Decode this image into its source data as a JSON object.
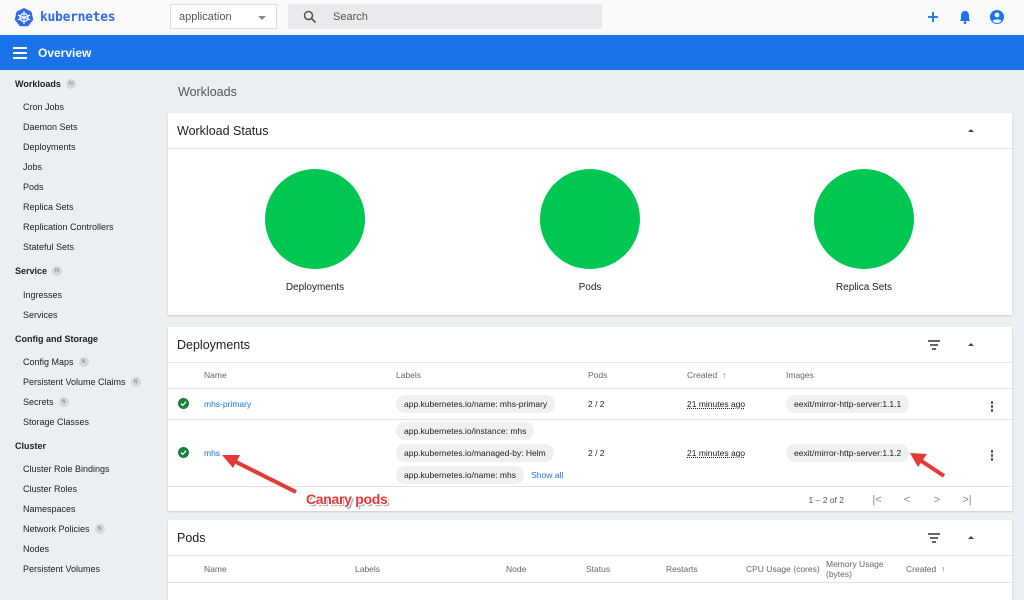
{
  "app": {
    "name": "kubernetes"
  },
  "topbar": {
    "namespace": "application",
    "search_placeholder": "Search",
    "icons": [
      "plus-icon",
      "bell-icon",
      "account-circle-icon"
    ]
  },
  "header": {
    "title": "Overview"
  },
  "sidebar": {
    "badge": "N",
    "sections": [
      {
        "label": "Workloads",
        "badge": true,
        "items": [
          {
            "label": "Cron Jobs"
          },
          {
            "label": "Daemon Sets"
          },
          {
            "label": "Deployments"
          },
          {
            "label": "Jobs"
          },
          {
            "label": "Pods"
          },
          {
            "label": "Replica Sets"
          },
          {
            "label": "Replication Controllers"
          },
          {
            "label": "Stateful Sets"
          }
        ]
      },
      {
        "label": "Service",
        "badge": true,
        "items": [
          {
            "label": "Ingresses"
          },
          {
            "label": "Services"
          }
        ]
      },
      {
        "label": "Config and Storage",
        "badge": false,
        "items": [
          {
            "label": "Config Maps",
            "badge": true
          },
          {
            "label": "Persistent Volume Claims",
            "badge": true
          },
          {
            "label": "Secrets",
            "badge": true
          },
          {
            "label": "Storage Classes"
          }
        ]
      },
      {
        "label": "Cluster",
        "badge": false,
        "items": [
          {
            "label": "Cluster Role Bindings"
          },
          {
            "label": "Cluster Roles"
          },
          {
            "label": "Namespaces"
          },
          {
            "label": "Network Policies",
            "badge": true
          },
          {
            "label": "Nodes"
          },
          {
            "label": "Persistent Volumes"
          }
        ]
      }
    ]
  },
  "main": {
    "page_title": "Workloads",
    "workload_status": {
      "title": "Workload Status",
      "items": [
        {
          "label": "Deployments",
          "status": "running",
          "color": "#00c752"
        },
        {
          "label": "Pods",
          "status": "running",
          "color": "#00c752"
        },
        {
          "label": "Replica Sets",
          "status": "running",
          "color": "#00c752"
        }
      ]
    },
    "deployments": {
      "title": "Deployments",
      "columns": [
        "Name",
        "Labels",
        "Pods",
        "Created",
        "Images"
      ],
      "sort_indicator": "↑",
      "rows": [
        {
          "name": "mhs-primary",
          "labels": [
            "app.kubernetes.io/name: mhs-primary"
          ],
          "pods": "2 / 2",
          "created": "21 minutes ago",
          "image": "eexit/mirror-http-server:1.1.1"
        },
        {
          "name": "mhs",
          "labels": [
            "app.kubernetes.io/instance: mhs",
            "app.kubernetes.io/managed-by: Helm",
            "app.kubernetes.io/name: mhs"
          ],
          "show_all": "Show all",
          "pods": "2 / 2",
          "created": "21 minutes ago",
          "image": "eexit/mirror-http-server:1.1.2"
        }
      ],
      "pagination": "1 – 2 of 2"
    },
    "pods": {
      "title": "Pods",
      "columns": [
        "Name",
        "Labels",
        "Node",
        "Status",
        "Restarts",
        "CPU Usage (cores)",
        "Memory Usage (bytes)",
        "Created"
      ],
      "sort_indicator": "↑"
    }
  },
  "annotation": {
    "text": "Canary pods",
    "color": "#e53935"
  }
}
